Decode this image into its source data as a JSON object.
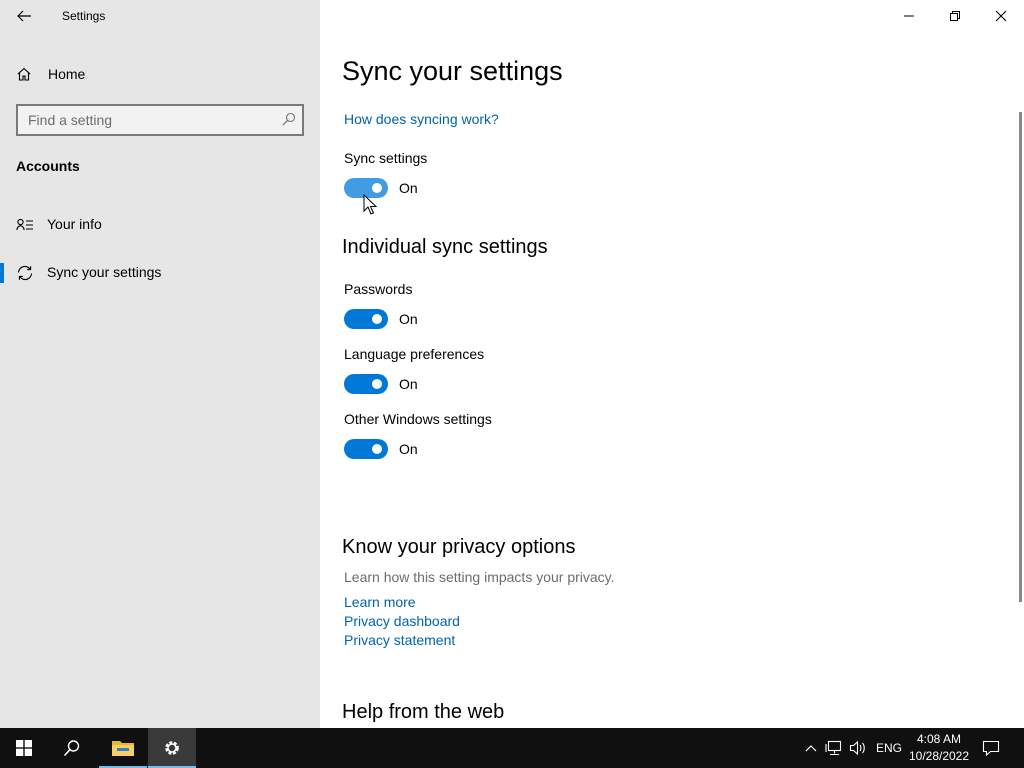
{
  "window": {
    "title": "Settings",
    "controls": [
      "minimize",
      "maximize",
      "close"
    ]
  },
  "sidebar": {
    "home_label": "Home",
    "search_placeholder": "Find a setting",
    "section_header": "Accounts",
    "items": [
      {
        "label": "Your info",
        "icon": "contact-info-icon",
        "selected": false
      },
      {
        "label": "Sync your settings",
        "icon": "sync-icon",
        "selected": true
      }
    ]
  },
  "main": {
    "title": "Sync your settings",
    "how_link": "How does syncing work?",
    "sync_settings_label": "Sync settings",
    "sync_settings_state": "On",
    "individual_header": "Individual sync settings",
    "individual": [
      {
        "label": "Passwords",
        "state": "On"
      },
      {
        "label": "Language preferences",
        "state": "On"
      },
      {
        "label": "Other Windows settings",
        "state": "On"
      }
    ],
    "privacy_header": "Know your privacy options",
    "privacy_desc": "Learn how this setting impacts your privacy.",
    "privacy_links": [
      "Learn more",
      "Privacy dashboard",
      "Privacy statement"
    ],
    "help_header": "Help from the web"
  },
  "taskbar": {
    "language": "ENG",
    "time": "4:08 AM",
    "date": "10/28/2022"
  },
  "colors": {
    "accent": "#0078d7",
    "link": "#0063b1",
    "sidebar_bg": "#e6e6e6",
    "taskbar_bg": "#101010"
  }
}
